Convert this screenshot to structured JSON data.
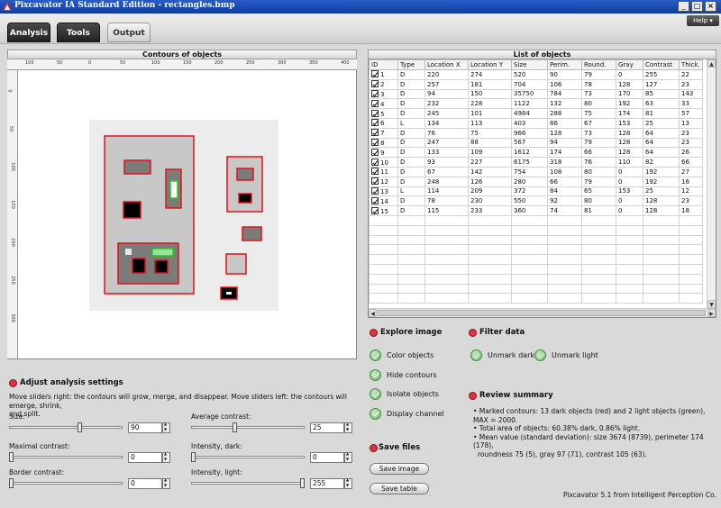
{
  "window": {
    "title": "Pixcavator IA Standard Edition - rectangles.bmp",
    "help_label": "Help"
  },
  "tabs": [
    {
      "label": "Analysis",
      "active": false
    },
    {
      "label": "Tools",
      "active": false
    },
    {
      "label": "Output",
      "active": true
    }
  ],
  "contours": {
    "title": "Contours of objects",
    "ruler_x": [
      "100",
      "50",
      "0",
      "50",
      "100",
      "150",
      "200",
      "250",
      "300",
      "350",
      "400"
    ],
    "ruler_y": [
      "0",
      "50",
      "100",
      "150",
      "200",
      "250",
      "300"
    ]
  },
  "list": {
    "title": "List of objects",
    "columns": [
      "ID",
      "Type",
      "Location X",
      "Location Y",
      "Size",
      "Perim.",
      "Round.",
      "Gray",
      "Contrast",
      "Thick."
    ],
    "rows": [
      [
        "1",
        "D",
        "220",
        "274",
        "520",
        "90",
        "79",
        "0",
        "255",
        "22"
      ],
      [
        "2",
        "D",
        "257",
        "181",
        "704",
        "106",
        "78",
        "128",
        "127",
        "23"
      ],
      [
        "3",
        "D",
        "94",
        "150",
        "35750",
        "784",
        "73",
        "170",
        "85",
        "143"
      ],
      [
        "4",
        "D",
        "232",
        "228",
        "1122",
        "132",
        "80",
        "192",
        "63",
        "33"
      ],
      [
        "5",
        "D",
        "245",
        "101",
        "4984",
        "288",
        "75",
        "174",
        "81",
        "57"
      ],
      [
        "6",
        "L",
        "134",
        "113",
        "403",
        "86",
        "67",
        "153",
        "25",
        "13"
      ],
      [
        "7",
        "D",
        "76",
        "75",
        "966",
        "128",
        "73",
        "128",
        "64",
        "23"
      ],
      [
        "8",
        "D",
        "247",
        "88",
        "567",
        "94",
        "79",
        "128",
        "64",
        "23"
      ],
      [
        "9",
        "D",
        "133",
        "109",
        "1612",
        "174",
        "66",
        "128",
        "64",
        "26"
      ],
      [
        "10",
        "D",
        "93",
        "227",
        "6175",
        "318",
        "76",
        "110",
        "82",
        "66"
      ],
      [
        "11",
        "D",
        "67",
        "142",
        "754",
        "108",
        "80",
        "0",
        "192",
        "27"
      ],
      [
        "12",
        "D",
        "248",
        "126",
        "280",
        "66",
        "79",
        "0",
        "192",
        "16"
      ],
      [
        "13",
        "L",
        "114",
        "209",
        "372",
        "84",
        "65",
        "153",
        "25",
        "12"
      ],
      [
        "14",
        "D",
        "78",
        "230",
        "550",
        "92",
        "80",
        "0",
        "128",
        "23"
      ],
      [
        "15",
        "D",
        "115",
        "233",
        "360",
        "74",
        "81",
        "0",
        "128",
        "18"
      ]
    ]
  },
  "explore": {
    "title": "Explore image",
    "options": [
      "Color objects",
      "Hide contours",
      "Isolate objects",
      "Display channel"
    ]
  },
  "filter": {
    "title": "Filter data",
    "options": [
      "Unmark dark",
      "Unmark light"
    ]
  },
  "save": {
    "title": "Save files",
    "buttons": [
      "Save image",
      "Save table"
    ]
  },
  "review": {
    "title": "Review summary",
    "lines": [
      "• Marked contours: 13 dark objects (red) and 2 light objects (green), MAX = 2000.",
      "• Total area of objects: 60.38% dark, 0.86% light.",
      "• Mean value (standard deviation): size 3674 (8739), perimeter 174 (178),",
      "roundness 75 (5), gray 97 (71), contrast 105 (63)."
    ]
  },
  "settings": {
    "title": "Adjust analysis settings",
    "description_line1": "Move sliders right: the contours will grow, merge, and disappear. Move sliders left: the contours will emerge, shrink,",
    "description_line2": "and split.",
    "sliders": [
      {
        "label": "Size:",
        "value": "90",
        "position": 0.63
      },
      {
        "label": "Average contrast:",
        "value": "25",
        "position": 0.38
      },
      {
        "label": "Maximal contrast:",
        "value": "0",
        "position": 0.0
      },
      {
        "label": "Intensity, dark:",
        "value": "0",
        "position": 0.0
      },
      {
        "label": "Border contrast:",
        "value": "0",
        "position": 0.0
      },
      {
        "label": "Intensity, light:",
        "value": "255",
        "position": 1.0
      }
    ]
  },
  "footer": {
    "credit": "Pixcavator 5.1 from Intelligent Perception Co."
  },
  "colors": {
    "contour_dark": "#e0121b",
    "contour_light": "#22c922",
    "titlebar": "#1a48b5"
  }
}
